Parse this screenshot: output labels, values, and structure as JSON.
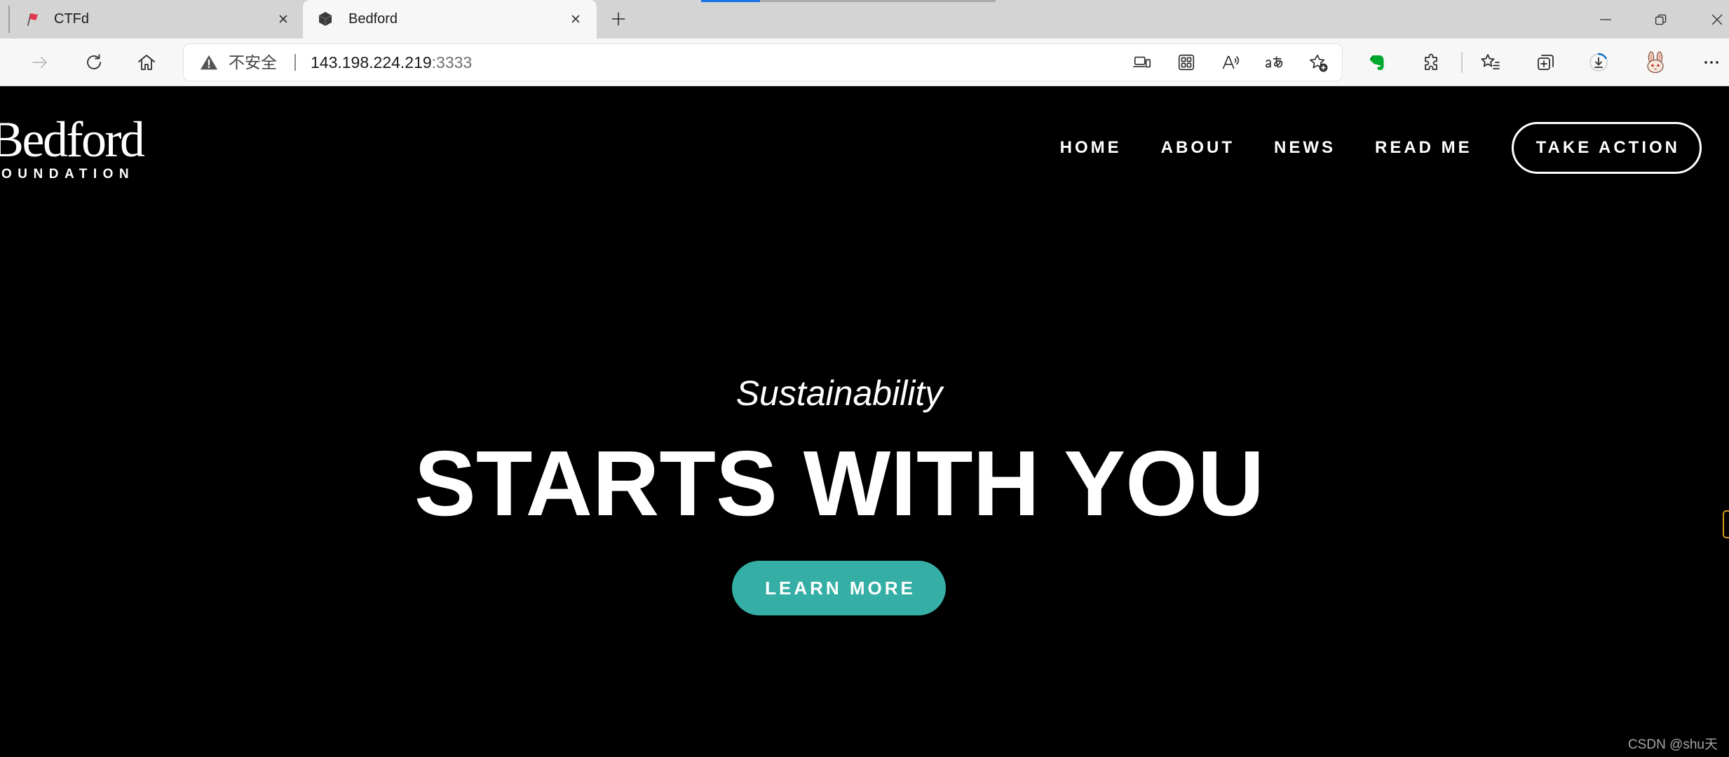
{
  "window": {
    "tabs": [
      {
        "title": "CTFd",
        "favicon": "ctfd-flag-favicon-icon",
        "active": false
      },
      {
        "title": "Bedford",
        "favicon": "cube-favicon-icon",
        "active": true
      }
    ],
    "controls": [
      "minimize-icon",
      "restore-icon",
      "close-icon"
    ],
    "new_tab_icon": "plus-icon"
  },
  "toolbar": {
    "nav_icons": [
      "forward-arrow-icon",
      "reload-icon",
      "home-icon"
    ],
    "address": {
      "security_icon": "warning-triangle-icon",
      "security_label": "不安全",
      "host": "143.198.224.219",
      "port": ":3333",
      "actions": [
        "device-icon",
        "apps-grid-icon",
        "read-aloud-icon",
        "translate-icon",
        "star-add-icon"
      ]
    },
    "right_icons": [
      "evernote-icon",
      "puzzle-icon",
      "favorites-icon",
      "collections-icon",
      "download-icon",
      "rabbit-avatar-icon",
      "more-icon"
    ],
    "download_in_progress": true
  },
  "site": {
    "logo": {
      "wordmark": "Bedford",
      "subline": "OUNDATION"
    },
    "nav": {
      "items": [
        {
          "label": "HOME"
        },
        {
          "label": "ABOUT"
        },
        {
          "label": "NEWS"
        },
        {
          "label": "READ ME"
        }
      ],
      "cta_label": "TAKE ACTION"
    },
    "hero": {
      "kicker": "Sustainability",
      "headline": "STARTS WITH YOU",
      "button_label": "LEARN MORE"
    }
  },
  "overlay": {
    "watermark": "CSDN @shu天"
  },
  "colors": {
    "page_background": "#000000",
    "accent_teal": "#35afa5",
    "tab_strip": "#d4d4d4",
    "toolbar": "#f7f7f7",
    "evernote_green": "#00a82d",
    "download_progress_blue": "#0067c0"
  }
}
